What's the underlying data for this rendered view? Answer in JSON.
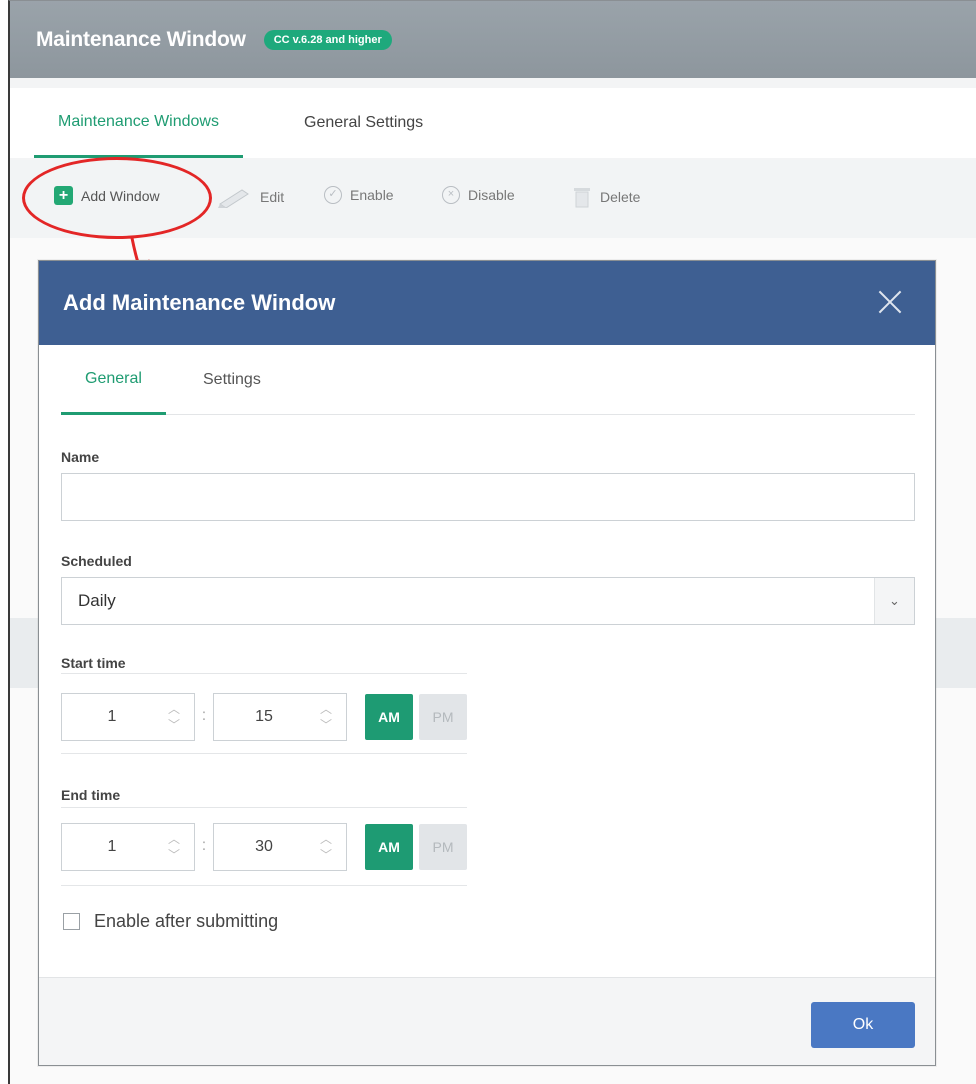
{
  "app": {
    "title": "Maintenance Window",
    "version_badge": "CC v.6.28 and higher"
  },
  "main_tabs": [
    {
      "label": "Maintenance Windows",
      "active": true
    },
    {
      "label": "General Settings",
      "active": false
    }
  ],
  "toolbar": {
    "add_label": "Add Window",
    "edit_label": "Edit",
    "enable_label": "Enable",
    "disable_label": "Disable",
    "delete_label": "Delete"
  },
  "dialog": {
    "title": "Add Maintenance Window",
    "tabs": [
      {
        "label": "General",
        "active": true
      },
      {
        "label": "Settings",
        "active": false
      }
    ],
    "name_label": "Name",
    "name_value": "",
    "scheduled_label": "Scheduled",
    "scheduled_value": "Daily",
    "start_time": {
      "label": "Start time",
      "hour": "1",
      "minute": "15",
      "am_label": "AM",
      "pm_label": "PM",
      "period": "AM"
    },
    "end_time": {
      "label": "End time",
      "hour": "1",
      "minute": "30",
      "am_label": "AM",
      "pm_label": "PM",
      "period": "AM"
    },
    "time_separator": ":",
    "enable_after_label": "Enable after submitting",
    "enable_after_checked": false,
    "ok_label": "Ok"
  },
  "colors": {
    "header_gray": "#8d969d",
    "accent_green": "#1f9c72",
    "dialog_blue": "#3e5f92",
    "ok_blue": "#4a78c3",
    "annotation_red": "#e32626"
  },
  "icons": {
    "add": "plus-square-icon",
    "edit": "pencil-icon",
    "enable": "check-circle-icon",
    "disable": "x-circle-icon",
    "delete": "trash-icon",
    "close": "close-icon",
    "caret": "chevron-down-icon",
    "spinner_up": "chevron-up-icon",
    "spinner_down": "chevron-down-icon"
  }
}
